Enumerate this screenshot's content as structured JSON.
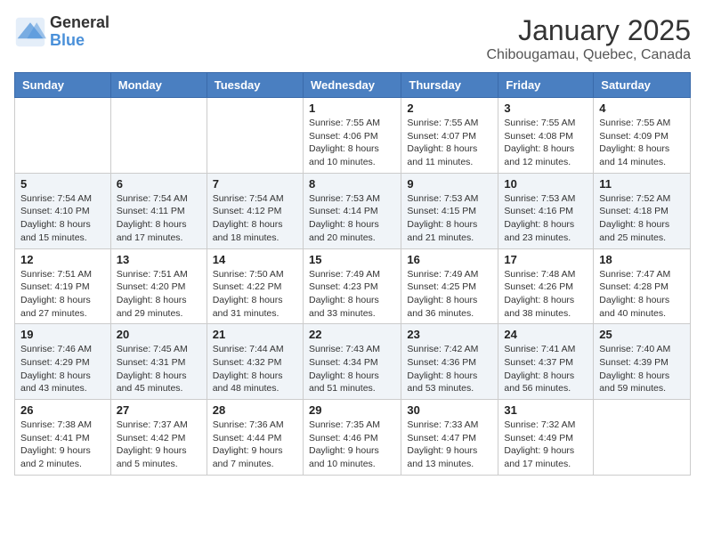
{
  "logo": {
    "general": "General",
    "blue": "Blue"
  },
  "header": {
    "month": "January 2025",
    "location": "Chibougamau, Quebec, Canada"
  },
  "days_of_week": [
    "Sunday",
    "Monday",
    "Tuesday",
    "Wednesday",
    "Thursday",
    "Friday",
    "Saturday"
  ],
  "weeks": [
    [
      {
        "day": "",
        "info": ""
      },
      {
        "day": "",
        "info": ""
      },
      {
        "day": "",
        "info": ""
      },
      {
        "day": "1",
        "info": "Sunrise: 7:55 AM\nSunset: 4:06 PM\nDaylight: 8 hours\nand 10 minutes."
      },
      {
        "day": "2",
        "info": "Sunrise: 7:55 AM\nSunset: 4:07 PM\nDaylight: 8 hours\nand 11 minutes."
      },
      {
        "day": "3",
        "info": "Sunrise: 7:55 AM\nSunset: 4:08 PM\nDaylight: 8 hours\nand 12 minutes."
      },
      {
        "day": "4",
        "info": "Sunrise: 7:55 AM\nSunset: 4:09 PM\nDaylight: 8 hours\nand 14 minutes."
      }
    ],
    [
      {
        "day": "5",
        "info": "Sunrise: 7:54 AM\nSunset: 4:10 PM\nDaylight: 8 hours\nand 15 minutes."
      },
      {
        "day": "6",
        "info": "Sunrise: 7:54 AM\nSunset: 4:11 PM\nDaylight: 8 hours\nand 17 minutes."
      },
      {
        "day": "7",
        "info": "Sunrise: 7:54 AM\nSunset: 4:12 PM\nDaylight: 8 hours\nand 18 minutes."
      },
      {
        "day": "8",
        "info": "Sunrise: 7:53 AM\nSunset: 4:14 PM\nDaylight: 8 hours\nand 20 minutes."
      },
      {
        "day": "9",
        "info": "Sunrise: 7:53 AM\nSunset: 4:15 PM\nDaylight: 8 hours\nand 21 minutes."
      },
      {
        "day": "10",
        "info": "Sunrise: 7:53 AM\nSunset: 4:16 PM\nDaylight: 8 hours\nand 23 minutes."
      },
      {
        "day": "11",
        "info": "Sunrise: 7:52 AM\nSunset: 4:18 PM\nDaylight: 8 hours\nand 25 minutes."
      }
    ],
    [
      {
        "day": "12",
        "info": "Sunrise: 7:51 AM\nSunset: 4:19 PM\nDaylight: 8 hours\nand 27 minutes."
      },
      {
        "day": "13",
        "info": "Sunrise: 7:51 AM\nSunset: 4:20 PM\nDaylight: 8 hours\nand 29 minutes."
      },
      {
        "day": "14",
        "info": "Sunrise: 7:50 AM\nSunset: 4:22 PM\nDaylight: 8 hours\nand 31 minutes."
      },
      {
        "day": "15",
        "info": "Sunrise: 7:49 AM\nSunset: 4:23 PM\nDaylight: 8 hours\nand 33 minutes."
      },
      {
        "day": "16",
        "info": "Sunrise: 7:49 AM\nSunset: 4:25 PM\nDaylight: 8 hours\nand 36 minutes."
      },
      {
        "day": "17",
        "info": "Sunrise: 7:48 AM\nSunset: 4:26 PM\nDaylight: 8 hours\nand 38 minutes."
      },
      {
        "day": "18",
        "info": "Sunrise: 7:47 AM\nSunset: 4:28 PM\nDaylight: 8 hours\nand 40 minutes."
      }
    ],
    [
      {
        "day": "19",
        "info": "Sunrise: 7:46 AM\nSunset: 4:29 PM\nDaylight: 8 hours\nand 43 minutes."
      },
      {
        "day": "20",
        "info": "Sunrise: 7:45 AM\nSunset: 4:31 PM\nDaylight: 8 hours\nand 45 minutes."
      },
      {
        "day": "21",
        "info": "Sunrise: 7:44 AM\nSunset: 4:32 PM\nDaylight: 8 hours\nand 48 minutes."
      },
      {
        "day": "22",
        "info": "Sunrise: 7:43 AM\nSunset: 4:34 PM\nDaylight: 8 hours\nand 51 minutes."
      },
      {
        "day": "23",
        "info": "Sunrise: 7:42 AM\nSunset: 4:36 PM\nDaylight: 8 hours\nand 53 minutes."
      },
      {
        "day": "24",
        "info": "Sunrise: 7:41 AM\nSunset: 4:37 PM\nDaylight: 8 hours\nand 56 minutes."
      },
      {
        "day": "25",
        "info": "Sunrise: 7:40 AM\nSunset: 4:39 PM\nDaylight: 8 hours\nand 59 minutes."
      }
    ],
    [
      {
        "day": "26",
        "info": "Sunrise: 7:38 AM\nSunset: 4:41 PM\nDaylight: 9 hours\nand 2 minutes."
      },
      {
        "day": "27",
        "info": "Sunrise: 7:37 AM\nSunset: 4:42 PM\nDaylight: 9 hours\nand 5 minutes."
      },
      {
        "day": "28",
        "info": "Sunrise: 7:36 AM\nSunset: 4:44 PM\nDaylight: 9 hours\nand 7 minutes."
      },
      {
        "day": "29",
        "info": "Sunrise: 7:35 AM\nSunset: 4:46 PM\nDaylight: 9 hours\nand 10 minutes."
      },
      {
        "day": "30",
        "info": "Sunrise: 7:33 AM\nSunset: 4:47 PM\nDaylight: 9 hours\nand 13 minutes."
      },
      {
        "day": "31",
        "info": "Sunrise: 7:32 AM\nSunset: 4:49 PM\nDaylight: 9 hours\nand 17 minutes."
      },
      {
        "day": "",
        "info": ""
      }
    ]
  ]
}
